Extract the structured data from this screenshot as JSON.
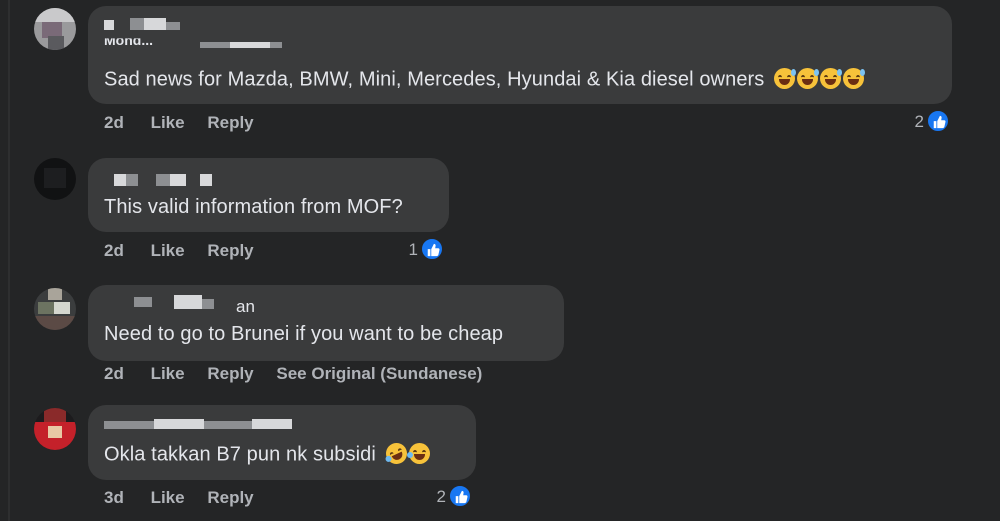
{
  "comments": [
    {
      "name_fragment": "Mohd...",
      "text": "Sad news for Mazda, BMW, Mini, Mercedes, Hyundai & Kia diesel owners",
      "emojis": [
        "grinning-sweat-emoji",
        "grinning-sweat-emoji",
        "grinning-sweat-emoji",
        "grinning-sweat-emoji"
      ],
      "time": "2d",
      "like": "Like",
      "reply": "Reply",
      "reaction_count": "2"
    },
    {
      "name_fragment": "",
      "text": "This valid information from MOF?",
      "emojis": [],
      "time": "2d",
      "like": "Like",
      "reply": "Reply",
      "reaction_count": "1"
    },
    {
      "name_fragment": "an",
      "text": "Need to go to Brunei if you want to be cheap",
      "emojis": [],
      "time": "2d",
      "like": "Like",
      "reply": "Reply",
      "see_original": "See Original (Sundanese)",
      "reaction_count": ""
    },
    {
      "name_fragment": "",
      "text": "Okla takkan B7 pun nk subsidi",
      "emojis": [
        "rolling-laughing-emoji",
        "tears-of-joy-emoji"
      ],
      "time": "3d",
      "like": "Like",
      "reply": "Reply",
      "reaction_count": "2"
    }
  ],
  "colors": {
    "background": "#242526",
    "bubble": "#3a3b3c",
    "text": "#e4e6eb",
    "meta": "#b0b3b8",
    "like_badge": "#1877f2"
  }
}
